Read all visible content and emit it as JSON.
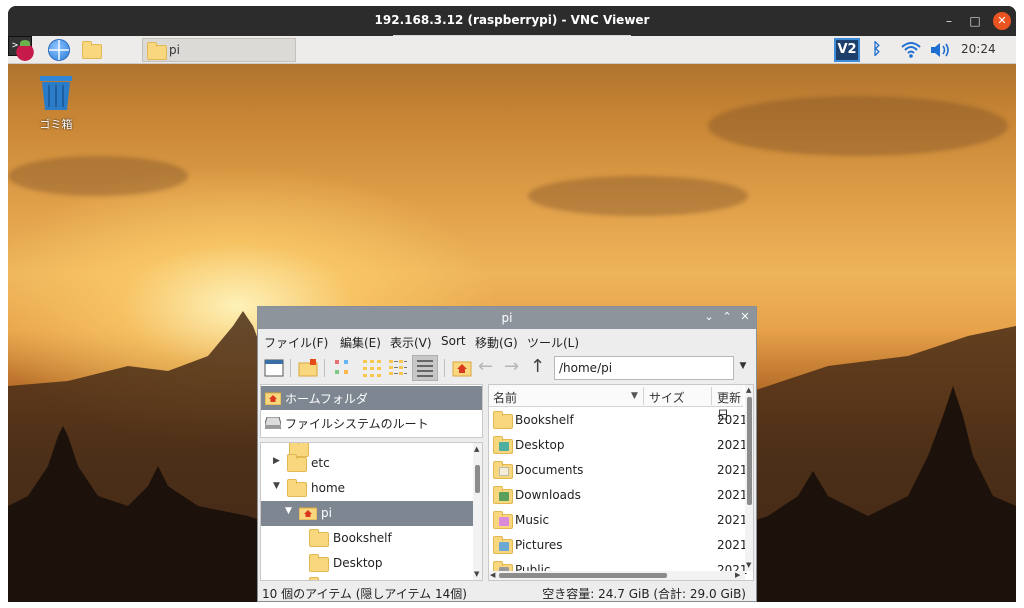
{
  "vnc": {
    "title": "192.168.3.12 (raspberrypi) - VNC Viewer",
    "minimize": "–",
    "maximize": "□",
    "close": "✕"
  },
  "taskbar": {
    "task_label": "pi",
    "clock": "20:24",
    "vnc_logo": "V2",
    "terminal_glyph": ">_"
  },
  "desktop": {
    "trash_label": "ゴミ箱"
  },
  "file_manager": {
    "title": "pi",
    "window_controls": {
      "minimize": "⌄",
      "maximize": "⌃",
      "close": "✕"
    },
    "menu": [
      "ファイル(F)",
      "編集(E)",
      "表示(V)",
      "Sort",
      "移動(G)",
      "ツール(L)"
    ],
    "path": "/home/pi",
    "places": {
      "home": "ホームフォルダ",
      "root": "ファイルシステムのルート"
    },
    "tree": [
      "etc",
      "home",
      "pi",
      "Bookshelf",
      "Desktop"
    ],
    "columns": {
      "name": "名前",
      "size": "サイズ",
      "modified": "更新日"
    },
    "files": [
      {
        "name": "Bookshelf",
        "date": "2021",
        "icon": "folder-icon"
      },
      {
        "name": "Desktop",
        "date": "2021",
        "icon": "desktop-folder-icon"
      },
      {
        "name": "Documents",
        "date": "2021",
        "icon": "documents-folder-icon"
      },
      {
        "name": "Downloads",
        "date": "2021",
        "icon": "downloads-folder-icon"
      },
      {
        "name": "Music",
        "date": "2021",
        "icon": "music-folder-icon"
      },
      {
        "name": "Pictures",
        "date": "2021",
        "icon": "pictures-folder-icon"
      },
      {
        "name": "Public",
        "date": "2021",
        "icon": "public-folder-icon"
      }
    ],
    "status": {
      "left": "10 個のアイテム (隠しアイテム 14個)",
      "right": "空き容量: 24.7 GiB (合計: 29.0 GiB)"
    }
  },
  "colors": {
    "titlebar": "#2c2c2c",
    "close_button": "#e95420",
    "selection": "#7e8791",
    "folder": "#f9d77e"
  }
}
